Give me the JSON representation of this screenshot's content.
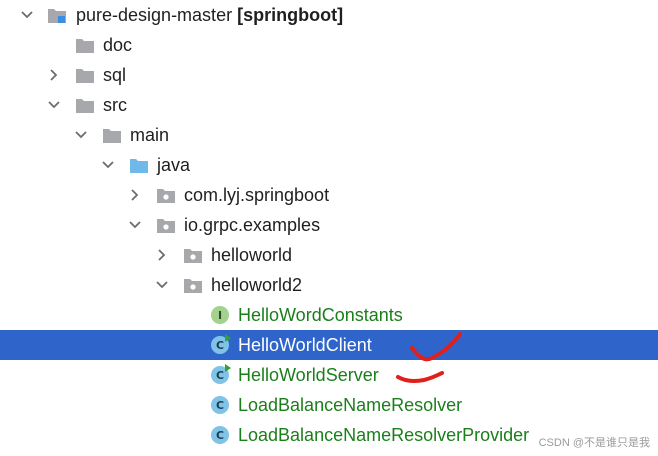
{
  "colors": {
    "selection": "#2f65ca",
    "class_text": "#1a7f1a",
    "folder": "#a6a8ab",
    "source_folder": "#6fb8e8"
  },
  "project": {
    "name": "pure-design-master",
    "module_tag": "[springboot]"
  },
  "tree": {
    "doc": "doc",
    "sql": "sql",
    "src": "src",
    "main": "main",
    "java": "java",
    "pkg_springboot": "com.lyj.springboot",
    "pkg_examples": "io.grpc.examples",
    "pkg_helloworld": "helloworld",
    "pkg_helloworld2": "helloworld2",
    "classes": [
      {
        "name": "HelloWordConstants",
        "kind": "interface",
        "badge": "I"
      },
      {
        "name": "HelloWorldClient",
        "kind": "class",
        "badge": "C",
        "selected": true,
        "runnable": true
      },
      {
        "name": "HelloWorldServer",
        "kind": "class",
        "badge": "C",
        "runnable": true
      },
      {
        "name": "LoadBalanceNameResolver",
        "kind": "class",
        "badge": "C"
      },
      {
        "name": "LoadBalanceNameResolverProvider",
        "kind": "class",
        "badge": "C"
      }
    ]
  },
  "watermark": "CSDN @不是谁只是我"
}
